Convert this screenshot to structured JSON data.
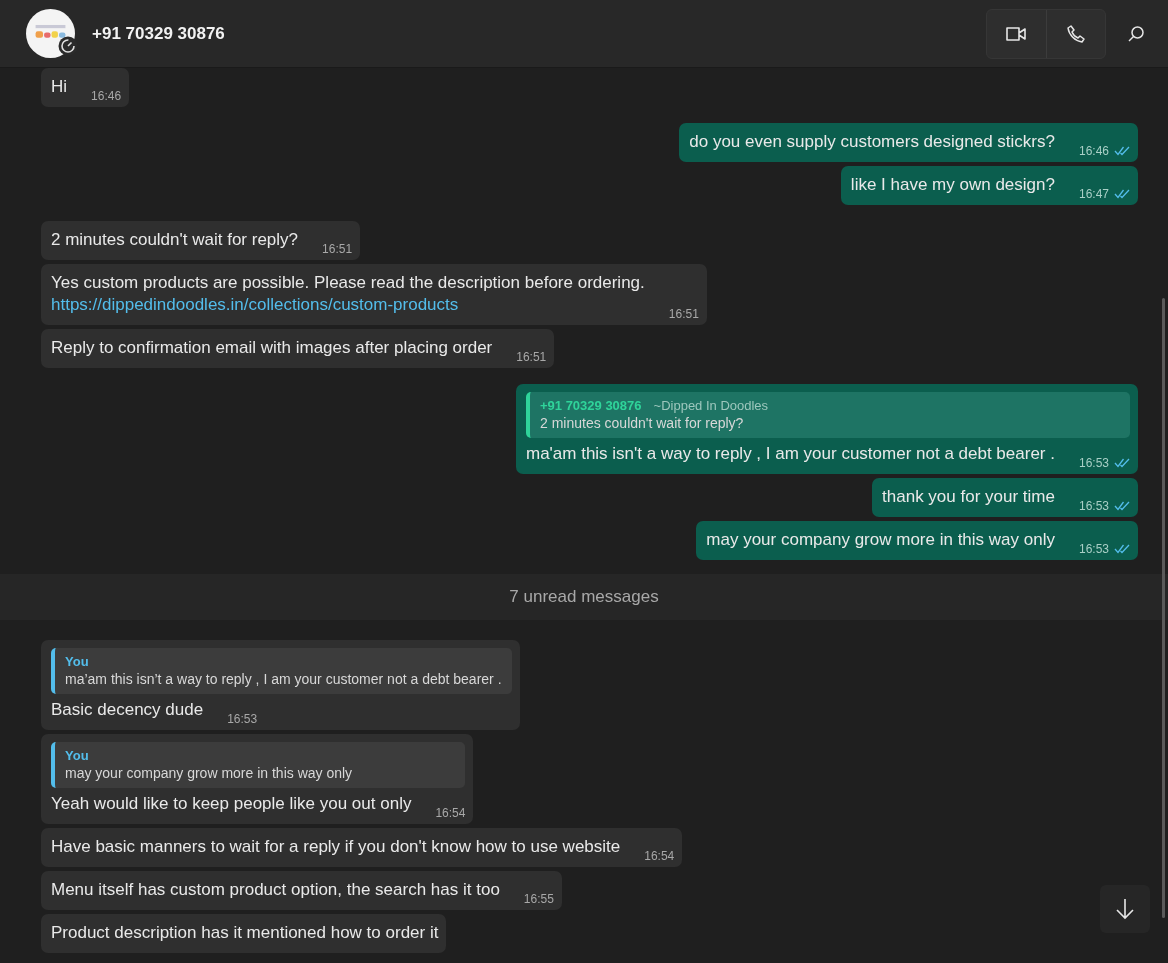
{
  "header": {
    "title": "+91 70329 30876"
  },
  "messages": [
    {
      "kind": "in",
      "text": "Hi",
      "time": "16:46"
    },
    {
      "kind": "out",
      "text": "do you even supply customers designed stickrs?",
      "time": "16:46",
      "read": true
    },
    {
      "kind": "out",
      "text": "like I have my own design?",
      "time": "16:47",
      "read": true
    },
    {
      "kind": "in",
      "text": "2 minutes couldn't wait for reply?",
      "time": "16:51"
    },
    {
      "kind": "in",
      "text": "Yes custom products are possible. Please read the description before ordering.",
      "link": "https://dippedindoodles.in/collections/custom-products",
      "time": "16:51"
    },
    {
      "kind": "in",
      "text": "Reply to confirmation email with images after placing order",
      "time": "16:51"
    },
    {
      "kind": "out",
      "quote": {
        "author": "+91 70329 30876",
        "note": "~Dipped In Doodles",
        "text": "2 minutes couldn't wait for reply?"
      },
      "text": "ma'am this isn't a way to reply , I am your customer not a debt bearer .",
      "time": "16:53",
      "read": true
    },
    {
      "kind": "out",
      "text": "thank you for your time",
      "time": "16:53",
      "read": true
    },
    {
      "kind": "out",
      "text": "may your company grow more in this way only",
      "time": "16:53",
      "read": true
    },
    {
      "kind": "divider",
      "text": "7 unread messages"
    },
    {
      "kind": "in",
      "quote": {
        "author": "You",
        "text": "ma’am this isn’t a way to reply , I am your customer not a debt bearer ."
      },
      "text": "Basic decency dude",
      "time": "16:53"
    },
    {
      "kind": "in",
      "quote": {
        "author": "You",
        "text": "may your company grow more in this way only"
      },
      "text": "Yeah would like to keep people like you out only",
      "time": "16:54"
    },
    {
      "kind": "in",
      "text": "Have basic manners to wait for a reply if you don't know how to use website",
      "time": "16:54"
    },
    {
      "kind": "in",
      "text": "Menu itself has custom product option, the search has it too",
      "time": "16:55"
    },
    {
      "kind": "in",
      "text": "Product description has it mentioned how to order it"
    }
  ]
}
